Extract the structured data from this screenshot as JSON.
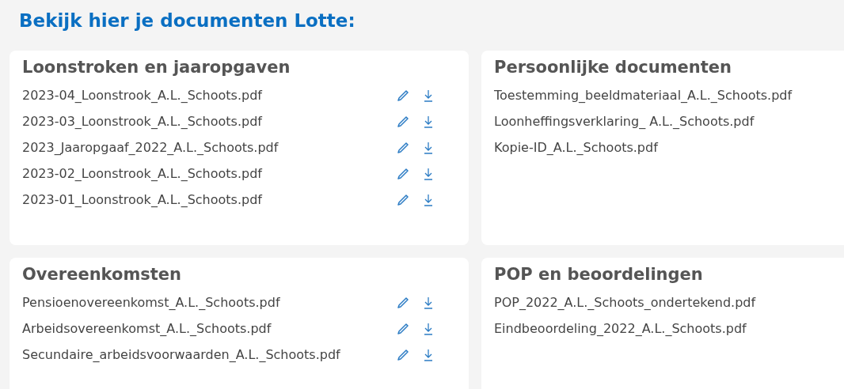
{
  "page_title": "Bekijk hier je documenten Lotte:",
  "cards": [
    {
      "title": "Loonstroken en jaaropgaven",
      "has_actions": true,
      "files": [
        "2023-04_Loonstrook_A.L._Schoots.pdf",
        "2023-03_Loonstrook_A.L._Schoots.pdf",
        "2023_Jaaropgaaf_2022_A.L._Schoots.pdf",
        "2023-02_Loonstrook_A.L._Schoots.pdf",
        "2023-01_Loonstrook_A.L._Schoots.pdf"
      ]
    },
    {
      "title": "Persoonlijke documenten",
      "files": [
        "Toestemming_beeldmateriaal_A.L._Schoots.pdf",
        "Loonheffingsverklaring_ A.L._Schoots.pdf",
        "Kopie-ID_A.L._Schoots.pdf"
      ]
    },
    {
      "title": "Overeenkomsten",
      "has_actions": true,
      "files": [
        "Pensioenovereenkomst_A.L._Schoots.pdf",
        "Arbeidsovereenkomst_A.L._Schoots.pdf",
        "Secundaire_arbeidsvoorwaarden_A.L._Schoots.pdf"
      ]
    },
    {
      "title": "POP en beoordelingen",
      "files": [
        "POP_2022_A.L._Schoots_ondertekend.pdf",
        "Eindbeoordeling_2022_A.L._Schoots.pdf"
      ]
    }
  ]
}
